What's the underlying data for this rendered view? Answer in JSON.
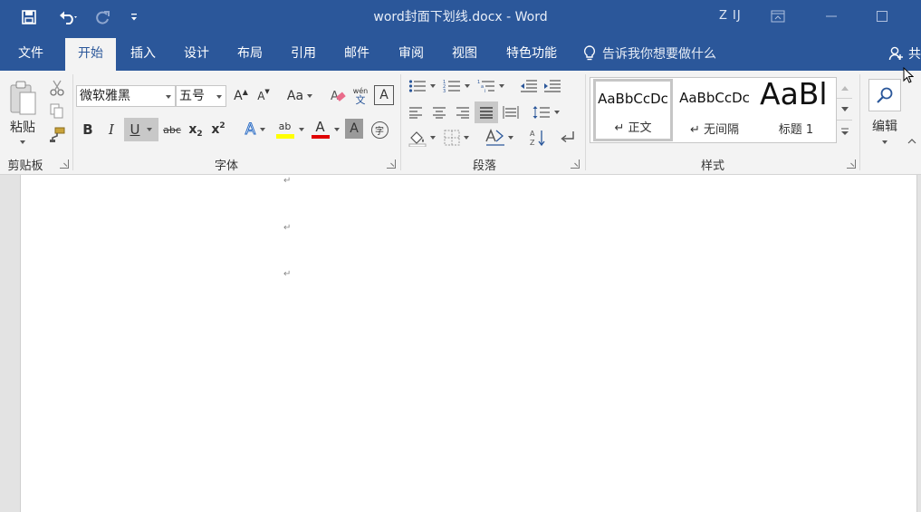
{
  "window": {
    "title": "word封面下划线.docx - Word",
    "user": "Z IJ"
  },
  "tabs": [
    {
      "label": "文件"
    },
    {
      "label": "开始"
    },
    {
      "label": "插入"
    },
    {
      "label": "设计"
    },
    {
      "label": "布局"
    },
    {
      "label": "引用"
    },
    {
      "label": "邮件"
    },
    {
      "label": "审阅"
    },
    {
      "label": "视图"
    },
    {
      "label": "特色功能"
    }
  ],
  "active_tab": "开始",
  "tell_me": "告诉我你想要做什么",
  "share_label": "共",
  "ribbon": {
    "clipboard": {
      "label": "剪贴板",
      "paste_label": "粘贴"
    },
    "font": {
      "label": "字体",
      "font_name": "微软雅黑",
      "font_size": "五号",
      "change_case": "Aa",
      "phonetic_top": "wén",
      "phonetic_bottom": "文",
      "enclose_char": "字",
      "char_border": "A",
      "bold": "B",
      "italic": "I",
      "underline": "U",
      "strike": "abc",
      "subscript": "x",
      "subscript_mark": "2",
      "superscript": "x",
      "superscript_mark": "2",
      "text_effect": "A",
      "highlight": "ab",
      "font_color": "A",
      "char_shading": "A",
      "grow": "A",
      "shrink": "A"
    },
    "paragraph": {
      "label": "段落"
    },
    "styles": {
      "label": "样式",
      "items": [
        {
          "sample": "AaBbCcDc",
          "name": "↵ 正文"
        },
        {
          "sample": "AaBbCcDc",
          "name": "↵ 无间隔"
        },
        {
          "sample": "AaBl",
          "name": "标题 1"
        }
      ]
    },
    "editing": {
      "label": "编辑"
    }
  },
  "document": {
    "paragraph_marks": [
      "↵",
      "↵",
      "↵"
    ]
  },
  "colors": {
    "accent": "#2b579a",
    "highlight": "#ffff00",
    "font_color": "#e00000"
  }
}
